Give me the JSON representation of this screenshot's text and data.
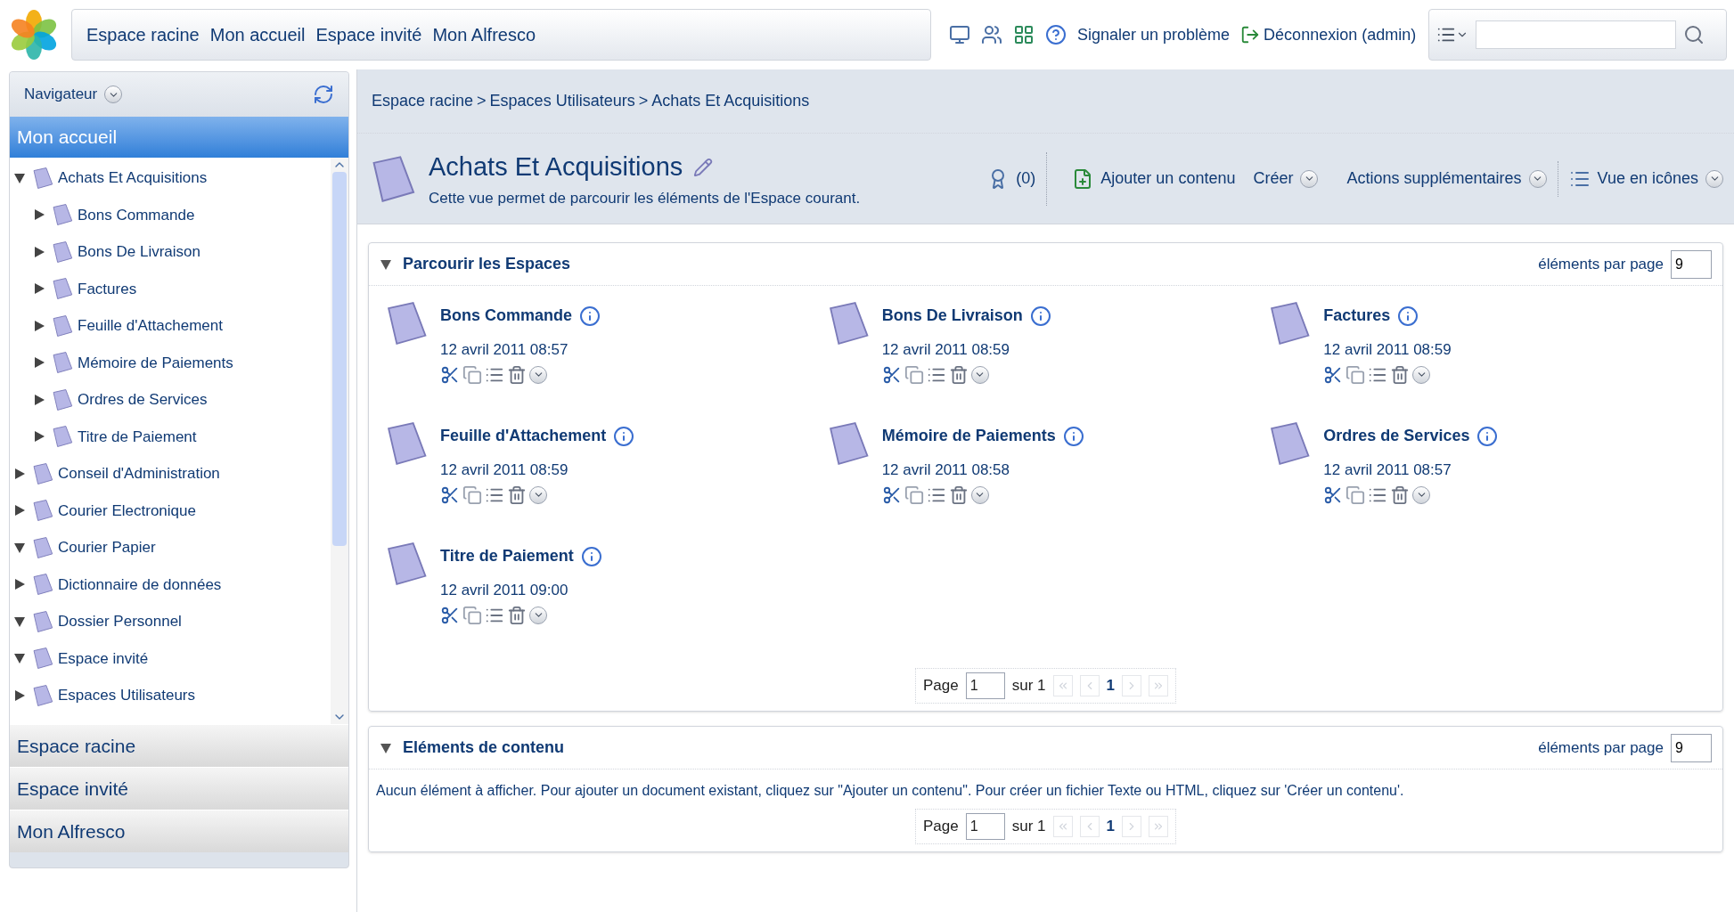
{
  "top_nav": {
    "links": [
      "Espace racine",
      "Mon accueil",
      "Espace invité",
      "Mon Alfresco"
    ]
  },
  "toolbar": {
    "report_link": "Signaler un problème",
    "logout_link": "Déconnexion (admin)"
  },
  "sidebar": {
    "title": "Navigateur",
    "active_section": "Mon accueil",
    "tree": [
      {
        "label": "Achats Et Acquisitions",
        "expanded": true,
        "children": [
          {
            "label": "Bons Commande",
            "expanded": false
          },
          {
            "label": "Bons De Livraison",
            "expanded": false
          },
          {
            "label": "Factures",
            "expanded": false
          },
          {
            "label": "Feuille d'Attachement",
            "expanded": false
          },
          {
            "label": "Mémoire de Paiements",
            "expanded": false
          },
          {
            "label": "Ordres de Services",
            "expanded": false
          },
          {
            "label": "Titre de Paiement",
            "expanded": false
          }
        ]
      },
      {
        "label": "Conseil d'Administration",
        "expanded": false
      },
      {
        "label": "Courier Electronique",
        "expanded": false
      },
      {
        "label": "Courier Papier",
        "expanded": true
      },
      {
        "label": "Dictionnaire de données",
        "expanded": false
      },
      {
        "label": "Dossier Personnel",
        "expanded": true
      },
      {
        "label": "Espace invité",
        "expanded": true
      },
      {
        "label": "Espaces Utilisateurs",
        "expanded": false
      }
    ],
    "sections": [
      "Espace racine",
      "Espace invité",
      "Mon Alfresco"
    ]
  },
  "breadcrumb": {
    "separator": ">",
    "items": [
      "Espace racine",
      "Espaces Utilisateurs",
      "Achats Et Acquisitions"
    ]
  },
  "header": {
    "title": "Achats Et Acquisitions",
    "description": "Cette vue permet de parcourir les éléments de l'Espace courant.",
    "count": "(0)",
    "actions": [
      "Ajouter un contenu",
      "Créer",
      "Actions supplémentaires",
      "Vue en icônes"
    ]
  },
  "spaces_panel": {
    "title": "Parcourir les Espaces",
    "per_page_label": "éléments par page",
    "per_page": "9",
    "items": [
      {
        "name": "Bons Commande",
        "date": "12 avril 2011 08:57"
      },
      {
        "name": "Bons De Livraison",
        "date": "12 avril 2011 08:59"
      },
      {
        "name": "Factures",
        "date": "12 avril 2011 08:59"
      },
      {
        "name": "Feuille d'Attachement",
        "date": "12 avril 2011 08:59"
      },
      {
        "name": "Mémoire de Paiements",
        "date": "12 avril 2011 08:58"
      },
      {
        "name": "Ordres de Services",
        "date": "12 avril 2011 08:57"
      },
      {
        "name": "Titre de Paiement",
        "date": "12 avril 2011 09:00"
      }
    ],
    "pager": {
      "label": "Page",
      "value": "1",
      "total": "sur 1",
      "current": "1"
    }
  },
  "content_panel": {
    "title": "Eléments de contenu",
    "per_page_label": "éléments par page",
    "per_page": "9",
    "message": "Aucun élément à afficher. Pour ajouter un document existant, cliquez sur \"Ajouter un contenu\". Pour créer un fichier Texte ou HTML, cliquez sur 'Créer un contenu'.",
    "pager": {
      "label": "Page",
      "value": "1",
      "total": "sur 1",
      "current": "1"
    }
  }
}
